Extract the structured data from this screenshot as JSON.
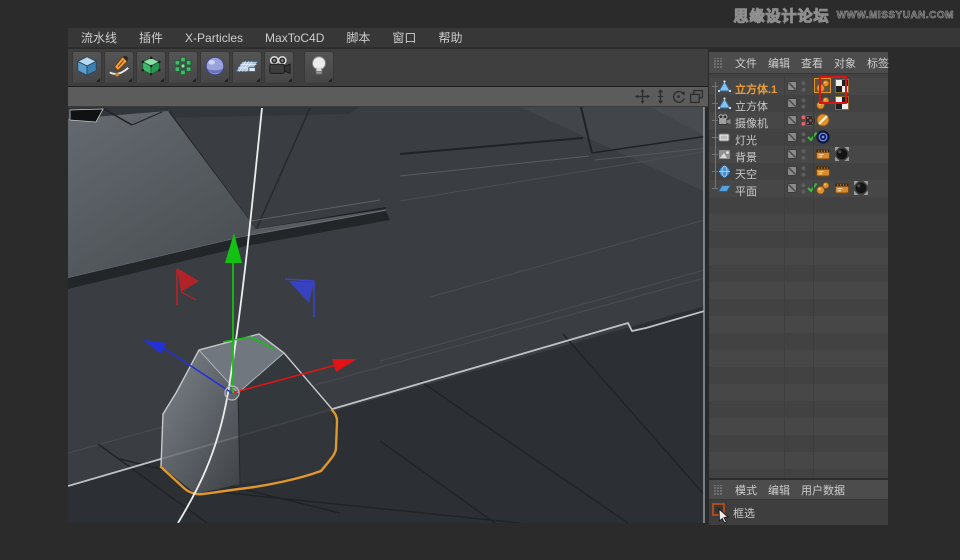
{
  "watermark": {
    "title": "思缘设计论坛",
    "url": "WWW.MISSYUAN.COM"
  },
  "menubar": {
    "items": [
      "流水线",
      "插件",
      "X-Particles",
      "MaxToC4D",
      "脚本",
      "窗口",
      "帮助"
    ]
  },
  "toolbar": {
    "tools": [
      {
        "name": "add-cube-tool",
        "icon": "cube"
      },
      {
        "name": "spline-pen-tool",
        "icon": "pen"
      },
      {
        "name": "edit-poly-tool",
        "icon": "greencube"
      },
      {
        "name": "array-tool",
        "icon": "array"
      },
      {
        "name": "field-sphere-tool",
        "icon": "sphere"
      },
      {
        "name": "floor-tool",
        "icon": "floor"
      },
      {
        "name": "camera-tool",
        "icon": "camera"
      },
      {
        "name": "light-tool",
        "icon": "bulb"
      }
    ]
  },
  "viewport": {
    "nav": [
      {
        "name": "pan"
      },
      {
        "name": "dolly"
      },
      {
        "name": "rotate"
      },
      {
        "name": "toggle-view"
      }
    ]
  },
  "object_manager": {
    "menu": [
      "文件",
      "编辑",
      "查看",
      "对象",
      "标签"
    ],
    "objects": [
      {
        "name": "立方体.1",
        "icon": "poly",
        "selected": true,
        "dots": "gray",
        "check": false,
        "extra": false,
        "tags": [
          "phong",
          "texture"
        ],
        "tag_selected": 0,
        "annotated": true
      },
      {
        "name": "立方体",
        "icon": "poly",
        "selected": false,
        "dots": "gray",
        "check": false,
        "extra": false,
        "tags": [
          "phong",
          "texture"
        ]
      },
      {
        "name": "摄像机",
        "icon": "camera",
        "selected": false,
        "dots": "red",
        "check": false,
        "extra": true,
        "tags": [
          "protection"
        ]
      },
      {
        "name": "灯光",
        "icon": "light",
        "selected": false,
        "dots": "gray",
        "check": true,
        "extra": false,
        "tags": [
          "target"
        ]
      },
      {
        "name": "背景",
        "icon": "background",
        "selected": false,
        "dots": "gray",
        "check": false,
        "extra": false,
        "tags": [
          "compositing",
          "material"
        ]
      },
      {
        "name": "天空",
        "icon": "sky",
        "selected": false,
        "dots": "gray",
        "check": false,
        "extra": false,
        "tags": [
          "compositing"
        ]
      },
      {
        "name": "平面",
        "icon": "plane",
        "selected": false,
        "dots": "gray",
        "check": true,
        "extra": false,
        "tags": [
          "phong",
          "compositing",
          "material"
        ]
      }
    ]
  },
  "attributes_panel": {
    "menu": [
      "模式",
      "编辑",
      "用户数据"
    ],
    "tool_label": "框选"
  },
  "colors": {
    "accent_orange": "#e89c3c",
    "annotation_red": "#d81414",
    "selection_orange": "#e0972e",
    "axis_x": "#e01414",
    "axis_y": "#12c112",
    "axis_z": "#2430d8",
    "panel_bg": "#454545",
    "viewport_bg": "#3a3e42"
  }
}
